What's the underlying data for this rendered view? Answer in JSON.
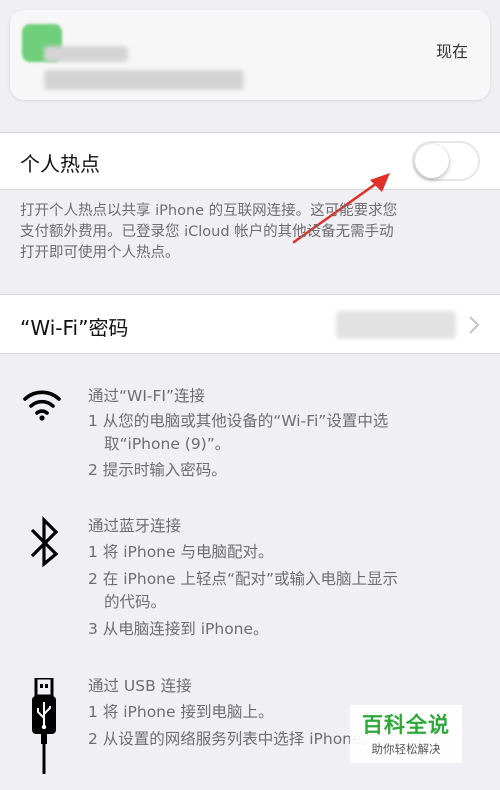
{
  "notification": {
    "time": "现在"
  },
  "hotspot": {
    "label": "个人热点",
    "toggle_on": false,
    "description_lines": [
      "打开个人热点以共享 iPhone 的互联网连接。这可能要求您",
      "支付额外费用。已登录您 iCloud 帐户的其他设备无需手动",
      "打开即可使用个人热点。"
    ]
  },
  "wifi_password": {
    "label": "“Wi-Fi”密码"
  },
  "instructions": {
    "wifi": {
      "heading": "通过“WI-FI”连接",
      "steps": [
        "1 从您的电脑或其他设备的“Wi-Fi”设置中选",
        "取“iPhone (9)”。",
        "2 提示时输入密码。"
      ]
    },
    "bluetooth": {
      "heading": "通过蓝牙连接",
      "steps": [
        "1 将 iPhone 与电脑配对。",
        "2 在 iPhone 上轻点“配对”或输入电脑上显示",
        "的代码。",
        "3 从电脑连接到 iPhone。"
      ]
    },
    "usb": {
      "heading": "通过 USB 连接",
      "steps": [
        "1 将 iPhone 接到电脑上。",
        "2 从设置的网络服务列表中选择 iPhone。"
      ]
    }
  },
  "watermark": {
    "title": "百科全说",
    "subtitle": "助你轻松解决"
  },
  "colors": {
    "background": "#efeff4",
    "annotation_arrow": "#e0302a",
    "watermark_green": "#2fa73a"
  }
}
